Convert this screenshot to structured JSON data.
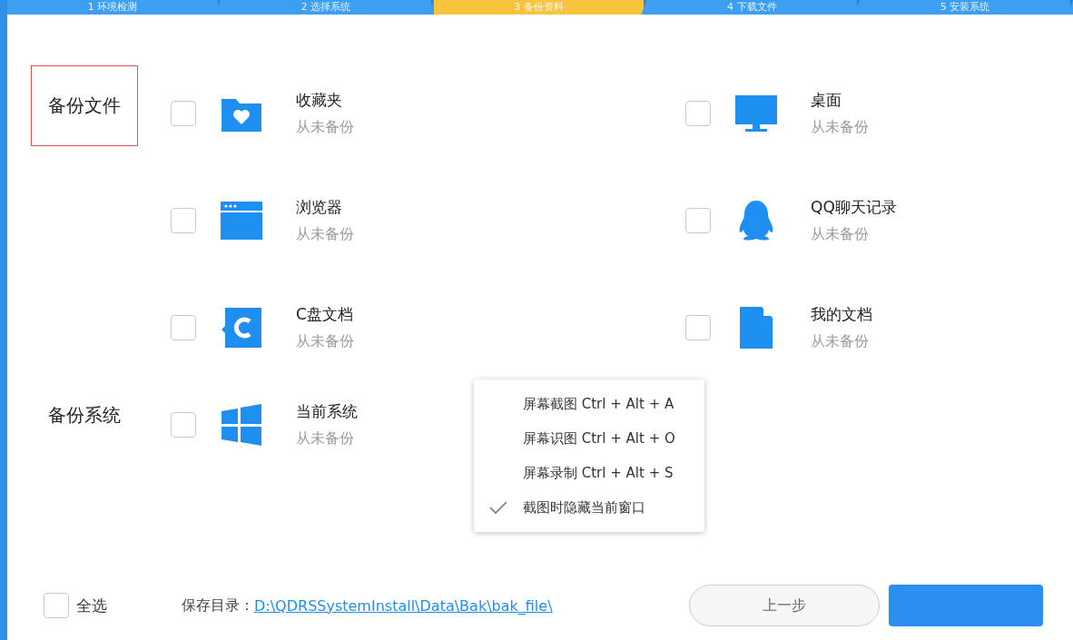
{
  "steps": [
    {
      "label": "1 环境检测",
      "selected": false
    },
    {
      "label": "2 选择系统",
      "selected": false
    },
    {
      "label": "3 备份资料",
      "selected": true
    },
    {
      "label": "4 下载文件",
      "selected": false
    },
    {
      "label": "5 安装系统",
      "selected": false
    }
  ],
  "sections": [
    {
      "label": "备份文件",
      "selected": true,
      "items": [
        {
          "kind": "favorites",
          "title": "收藏夹",
          "status": "从未备份",
          "checked": false
        },
        {
          "kind": "desktop",
          "title": "桌面",
          "status": "从未备份",
          "checked": false
        },
        {
          "kind": "browser",
          "title": "浏览器",
          "status": "从未备份",
          "checked": false
        },
        {
          "kind": "qq",
          "title": "QQ聊天记录",
          "status": "从未备份",
          "checked": false
        },
        {
          "kind": "cdrive",
          "title": "C盘文档",
          "status": "从未备份",
          "checked": false
        },
        {
          "kind": "document",
          "title": "我的文档",
          "status": "从未备份",
          "checked": false
        }
      ]
    },
    {
      "label": "备份系统",
      "selected": false,
      "items": [
        {
          "kind": "windows",
          "title": "当前系统",
          "status": "从未备份",
          "checked": false
        }
      ]
    }
  ],
  "context_menu": {
    "items": [
      {
        "label": "屏幕截图 Ctrl + Alt + A",
        "checked": false
      },
      {
        "label": "屏幕识图 Ctrl + Alt + O",
        "checked": false
      },
      {
        "label": "屏幕录制 Ctrl + Alt + S",
        "checked": false
      },
      {
        "label": "截图时隐藏当前窗口",
        "checked": true
      }
    ]
  },
  "footer": {
    "select_all": {
      "label": "全选",
      "checked": false
    },
    "save_dir_label": "保存目录：",
    "save_dir_path": "D:\\QDRSSystemInstall\\Data\\Bak\\bak_file\\",
    "prev_button": "上一步"
  }
}
